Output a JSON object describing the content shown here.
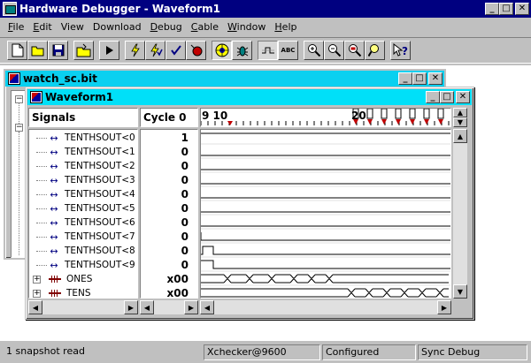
{
  "app": {
    "title": "Hardware Debugger - Waveform1"
  },
  "menu": [
    {
      "label": "File",
      "accel": "F",
      "rest": "ile"
    },
    {
      "label": "Edit",
      "accel": "E",
      "rest": "dit"
    },
    {
      "label": "View",
      "accel": "V",
      "rest": "iew"
    },
    {
      "label": "Download",
      "accel": "D",
      "rest": "ownload"
    },
    {
      "label": "Debug",
      "accel": "D",
      "rest": "ebug"
    },
    {
      "label": "Cable",
      "accel": "C",
      "rest": "able"
    },
    {
      "label": "Window",
      "accel": "W",
      "rest": "indow"
    },
    {
      "label": "Help",
      "accel": "H",
      "rest": "elp"
    }
  ],
  "toolbar": {
    "abc_label": "ABC"
  },
  "watch_window": {
    "title": "watch_sc.bit"
  },
  "waveform_window": {
    "title": "Waveform1",
    "signals_header": "Signals",
    "cycle_header": "Cycle 0",
    "ruler_left_label": "9 10",
    "ruler_right_label": "20",
    "signals": [
      {
        "name": "TENTHSOUT<0",
        "value": "1",
        "type": "bit"
      },
      {
        "name": "TENTHSOUT<1",
        "value": "0",
        "type": "bit"
      },
      {
        "name": "TENTHSOUT<2",
        "value": "0",
        "type": "bit"
      },
      {
        "name": "TENTHSOUT<3",
        "value": "0",
        "type": "bit"
      },
      {
        "name": "TENTHSOUT<4",
        "value": "0",
        "type": "bit"
      },
      {
        "name": "TENTHSOUT<5",
        "value": "0",
        "type": "bit"
      },
      {
        "name": "TENTHSOUT<6",
        "value": "0",
        "type": "bit"
      },
      {
        "name": "TENTHSOUT<7",
        "value": "0",
        "type": "bit"
      },
      {
        "name": "TENTHSOUT<8",
        "value": "0",
        "type": "bit"
      },
      {
        "name": "TENTHSOUT<9",
        "value": "0",
        "type": "bit"
      },
      {
        "name": "ONES",
        "value": "x00",
        "type": "bus"
      },
      {
        "name": "TENS",
        "value": "x00",
        "type": "bus"
      }
    ]
  },
  "status": {
    "message": "1 snapshot read",
    "cable": "Xchecker@9600",
    "state": "Configured",
    "mode": "Sync Debug"
  },
  "colors": {
    "active_title": "#000080",
    "child_title": "#00e0f8",
    "marker": "#c00000",
    "bus_icon": "#800000"
  }
}
